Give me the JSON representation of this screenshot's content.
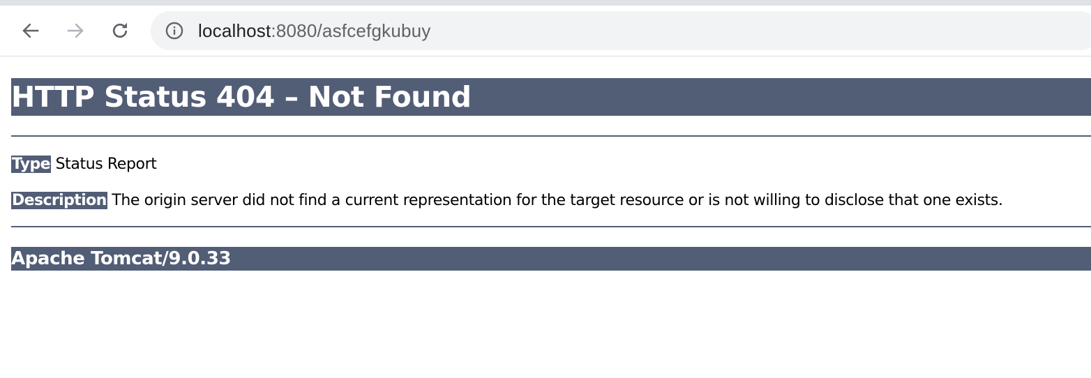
{
  "browser": {
    "url_host": "localhost",
    "url_rest": ":8080/asfcefgkubuy",
    "icons": {
      "back": "arrow-left-icon",
      "forward": "arrow-right-icon",
      "reload": "reload-icon",
      "info": "info-icon"
    }
  },
  "page": {
    "heading": "HTTP Status 404 – Not Found",
    "type_label": "Type",
    "type_value": " Status Report",
    "description_label": "Description",
    "description_value": " The origin server did not find a current representation for the target resource or is not willing to disclose that one exists.",
    "server_signature": "Apache Tomcat/9.0.33"
  },
  "colors": {
    "accent": "#525d76",
    "omnibox_bg": "#f1f3f4",
    "top_strip": "#dee1e6"
  }
}
